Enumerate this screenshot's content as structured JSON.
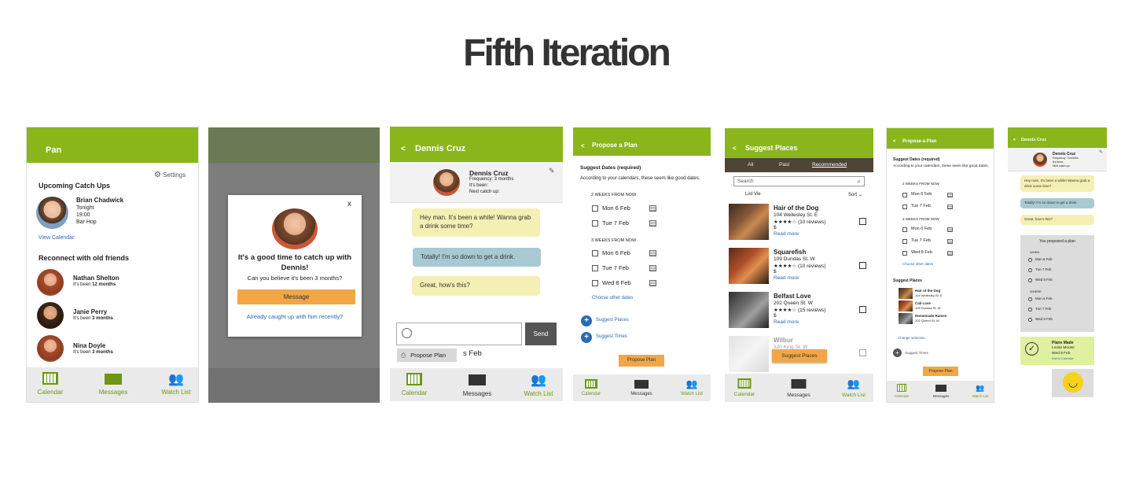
{
  "title": "Fifth Iteration",
  "colors": {
    "header_green": "#8ab61b",
    "accent_orange": "#f1a747",
    "link_blue": "#2a6ab5"
  },
  "nav": {
    "calendar": "Calendar",
    "messages": "Messages",
    "watch": "Watch List"
  },
  "s1": {
    "header": "Pan",
    "settings": "Settings",
    "upcoming": "Upcoming Catch Ups",
    "event": {
      "name": "Brian Chadwick",
      "when": "Tonight",
      "time": "19:00",
      "place": "Bar Hop"
    },
    "view_calendar": "View Calendar",
    "reconnect": "Reconnect with old friends",
    "its_been": "It's been",
    "friends": [
      {
        "name": "Nathan Shelton",
        "period": "12 months"
      },
      {
        "name": "Janie Perry",
        "period": "3 months"
      },
      {
        "name": "Nina Doyle",
        "period": "3 months"
      }
    ]
  },
  "s2": {
    "close": "x",
    "headline": "It's a good time to catch up with Dennis!",
    "subtext": "Can you believe it's been 3 months?",
    "message_btn": "Message",
    "already": "Already caught up with him recently?"
  },
  "s3": {
    "back": "<",
    "header": "Dennis Cruz",
    "name": "Dennis Cruz",
    "frequency": "Frequency: 3 months",
    "been": "It's been:",
    "next": "Next catch up:",
    "msg1": "Hey man. It's been a while! Wanna grab a drink some time?",
    "msg2": "Totally! I'm so down to get a drink.",
    "msg3": "Great, how's this?",
    "send": "Send",
    "propose": "Propose Plan",
    "peek": "s Feb"
  },
  "s4": {
    "back": "<",
    "header": "Propose a Plan",
    "section": "Suggest Dates (required)",
    "desc": "According to your calendars, these seem like good dates.",
    "group1": "2 WEEKS FROM NOW",
    "group2": "3 WEEKS FROM NOW",
    "dates1": [
      "Mon 6 Feb",
      "Tue 7 Feb"
    ],
    "dates2": [
      "Mon 6 Feb",
      "Tue 7 Feb",
      "Wed 8 Feb"
    ],
    "other": "Choose other dates",
    "suggest_places": "Suggest Places",
    "suggest_times": "Suggest Times",
    "propose_btn": "Propose Plan"
  },
  "s5": {
    "back": "<",
    "header": "Suggest Places",
    "tabs": [
      "All",
      "Past",
      "Recommended"
    ],
    "search": "Search",
    "list_view": "List Vie",
    "sort": "Sort",
    "places": [
      {
        "name": "Hair of the Dog",
        "addr": "104 Wellesley St. E",
        "rating": "★★★★☆ (10 reviews)",
        "price": "$",
        "more": "Read more"
      },
      {
        "name": "Squarefish",
        "addr": "109 Dundas St. W",
        "rating": "★★★★☆ (10 reviews)",
        "price": "$",
        "more": "Read more"
      },
      {
        "name": "Belfast Love",
        "addr": "202 Queen St. W",
        "rating": "★★★★☆ (15 reviews)",
        "price": "$",
        "more": "Read more"
      },
      {
        "name": "Wilbur",
        "addr": "320 King St. W"
      }
    ],
    "suggest_btn": "Suggest Places"
  },
  "s6": {
    "back": "<",
    "header": "Propose a Plan",
    "section": "Suggest Dates (required)",
    "desc": "According to your calendars, these seem like good dates.",
    "group1": "2 WEEKS FROM NOW",
    "group2": "3 WEEKS FROM NOW",
    "dates1": [
      "Mon 6 Feb",
      "Tue 7 Feb"
    ],
    "dates2": [
      "Mon 6 Feb",
      "Tue 7 Feb",
      "Wed 8 Feb"
    ],
    "other": "Choose other dates",
    "places_title": "Suggest Places",
    "places": [
      {
        "name": "Hair of the Dog",
        "addr": "104 Wellesley St. E"
      },
      {
        "name": "Cali Love",
        "addr": "109 Dundas St. W"
      },
      {
        "name": "Homemade Ramen",
        "addr": "202 Queen St. W"
      }
    ],
    "change": "Change selection",
    "suggest_times": "Suggest Times",
    "propose_btn": "Propose Plan"
  },
  "s7": {
    "back": "<",
    "header": "Dennis Cruz",
    "name": "Dennis Cruz",
    "frequency": "Frequency: 3 months",
    "been": "It's been:",
    "next": "Next catch up:",
    "msg1": "Hey man. It's been a while! Wanna grab a drink some time?",
    "msg2": "Totally! I'm so down to get a drink.",
    "msg3": "Great, how's this?",
    "proposed": "You proposed a plan",
    "when": "WHEN",
    "when_opts": [
      "Mon 6 Feb",
      "Tue  7 Feb",
      "Wed 8 Feb"
    ],
    "where": "WHERE",
    "where_opts": [
      "Mon 6 Feb",
      "Tue  7 Feb",
      "Wed 8 Feb"
    ],
    "made": "Plans Made",
    "made_place": "Loose Moose",
    "made_date": "Wed 8 Feb",
    "add_cal": "Add to Calendar"
  }
}
